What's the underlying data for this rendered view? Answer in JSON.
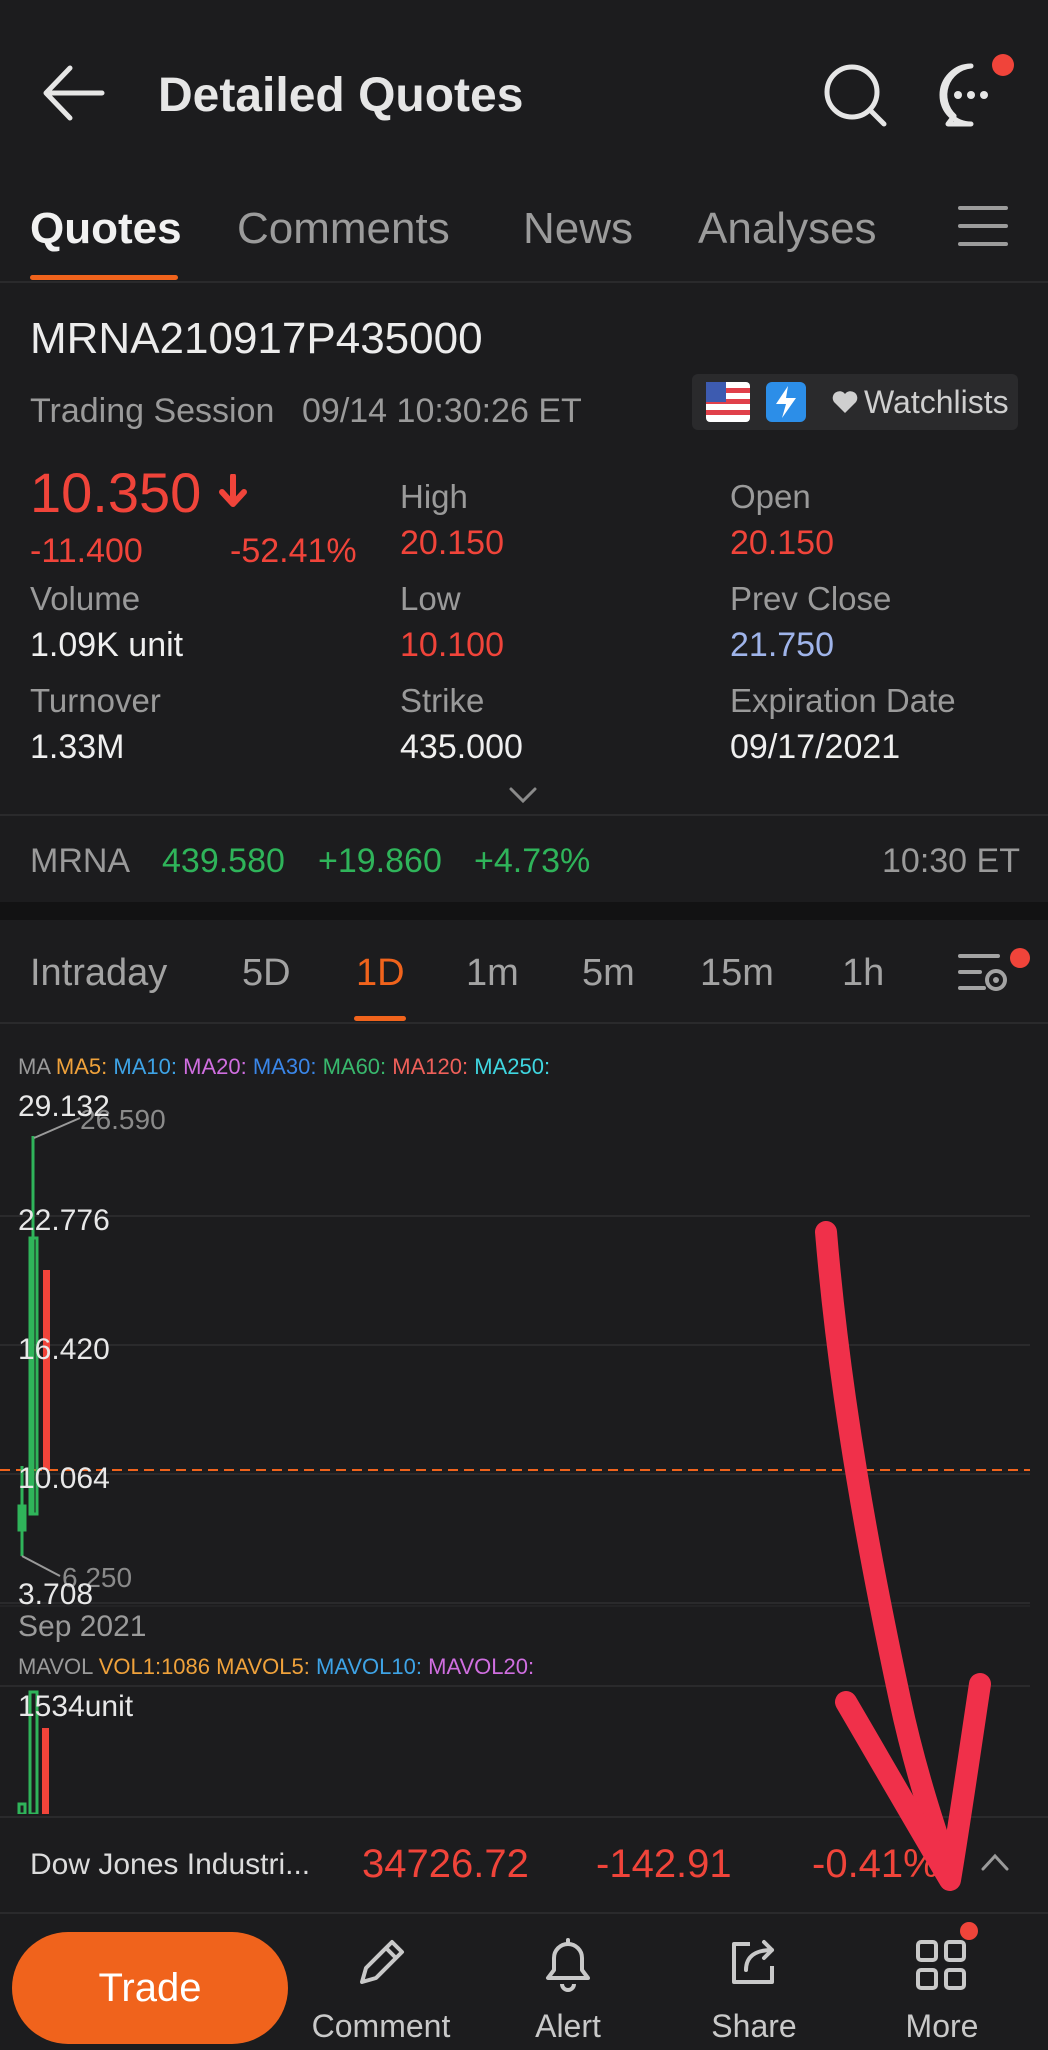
{
  "header": {
    "title": "Detailed Quotes"
  },
  "tabs": [
    {
      "label": "Quotes",
      "active": true
    },
    {
      "label": "Comments"
    },
    {
      "label": "News"
    },
    {
      "label": "Analyses"
    }
  ],
  "quote": {
    "symbol": "MRNA210917P435000",
    "session_label": "Trading Session",
    "session_time": "09/14 10:30:26 ET",
    "watchlists_label": "Watchlists",
    "price": "10.350",
    "change": "-11.400",
    "change_pct": "-52.41%",
    "stats": {
      "high_label": "High",
      "high": "20.150",
      "open_label": "Open",
      "open": "20.150",
      "volume_label": "Volume",
      "volume": "1.09K unit",
      "low_label": "Low",
      "low": "10.100",
      "prev_close_label": "Prev Close",
      "prev_close": "21.750",
      "turnover_label": "Turnover",
      "turnover": "1.33M",
      "strike_label": "Strike",
      "strike": "435.000",
      "expiration_label": "Expiration Date",
      "expiration": "09/17/2021"
    }
  },
  "underlying": {
    "symbol": "MRNA",
    "price": "439.580",
    "change": "+19.860",
    "change_pct": "+4.73%",
    "time": "10:30 ET"
  },
  "chart_tabs": [
    {
      "label": "Intraday"
    },
    {
      "label": "5D"
    },
    {
      "label": "1D",
      "active": true
    },
    {
      "label": "1m"
    },
    {
      "label": "5m"
    },
    {
      "label": "15m"
    },
    {
      "label": "1h"
    }
  ],
  "ma_legend": {
    "prefix": "MA",
    "items": [
      {
        "label": "MA5:",
        "color": "#f0a23b"
      },
      {
        "label": "MA10:",
        "color": "#3ea3e6"
      },
      {
        "label": "MA20:",
        "color": "#d06ee0"
      },
      {
        "label": "MA30:",
        "color": "#3a86e8"
      },
      {
        "label": "MA60:",
        "color": "#38b86d"
      },
      {
        "label": "MA120:",
        "color": "#f0605a"
      },
      {
        "label": "MA250:",
        "color": "#3fd6e0"
      }
    ]
  },
  "chart_data": {
    "type": "candlestick",
    "y_ticks": [
      "29.132",
      "22.776",
      "16.420",
      "10.064",
      "3.708"
    ],
    "high_marker": "26.590",
    "low_marker": "6.250",
    "current_line": 10.35,
    "x_label": "Sep 2021"
  },
  "volume_legend": {
    "prefix": "MAVOL",
    "items": [
      {
        "label": "VOL1:1086",
        "color": "#f0a23b"
      },
      {
        "label": "MAVOL5:",
        "color": "#f0a23b"
      },
      {
        "label": "MAVOL10:",
        "color": "#3ea3e6"
      },
      {
        "label": "MAVOL20:",
        "color": "#d06ee0"
      }
    ],
    "max_label": "1534unit"
  },
  "index_ticker": {
    "name": "Dow Jones Industri...",
    "value": "34726.72",
    "change": "-142.91",
    "change_pct": "-0.41%"
  },
  "bottom_bar": {
    "trade": "Trade",
    "comment": "Comment",
    "alert": "Alert",
    "share": "Share",
    "more": "More"
  },
  "colors": {
    "accent": "#f0631c",
    "down": "#f0443a",
    "up": "#2fb45a",
    "annotation": "#f0304a"
  }
}
